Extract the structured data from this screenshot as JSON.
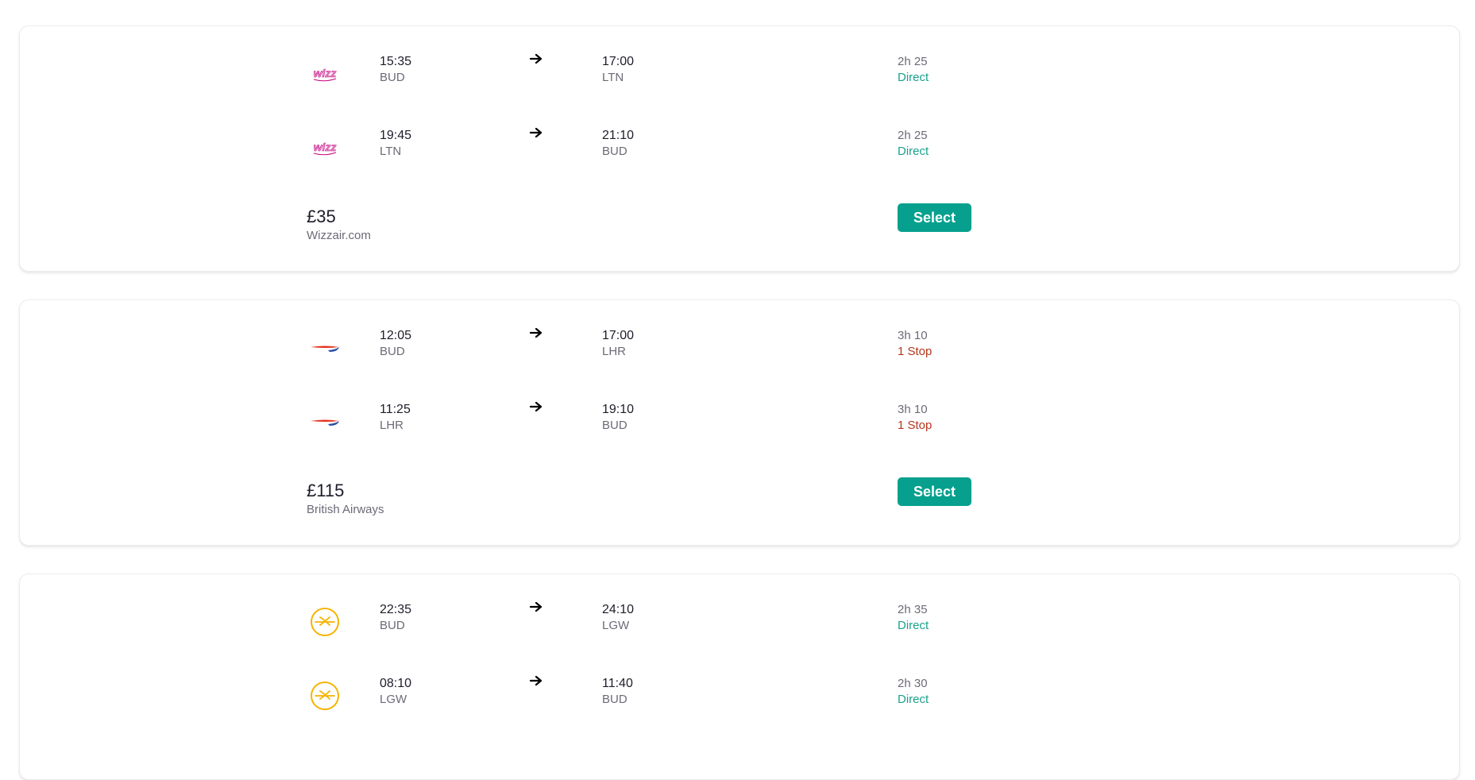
{
  "results": [
    {
      "airline": "Wizz Air",
      "legs": [
        {
          "logo": "wizz-air-logo",
          "dep_time": "15:35",
          "dep_code": "BUD",
          "arr_time": "17:00",
          "arr_code": "LTN",
          "duration": "2h 25",
          "stops": "Direct"
        },
        {
          "logo": "wizz-air-logo",
          "dep_time": "19:45",
          "dep_code": "LTN",
          "arr_time": "21:10",
          "arr_code": "BUD",
          "duration": "2h 25",
          "stops": "Direct"
        }
      ],
      "price": "£35",
      "provider": "Wizzair.com",
      "select_label": "Select"
    },
    {
      "airline": "British Airways",
      "legs": [
        {
          "logo": "british-airways-logo",
          "dep_time": "12:05",
          "dep_code": "BUD",
          "arr_time": "17:00",
          "arr_code": "LHR",
          "duration": "3h 10",
          "stops": "1 Stop"
        },
        {
          "logo": "british-airways-logo",
          "dep_time": "11:25",
          "dep_code": "LHR",
          "arr_time": "19:10",
          "arr_code": "BUD",
          "duration": "3h 10",
          "stops": "1 Stop"
        }
      ],
      "price": "£115",
      "provider": "British Airways",
      "select_label": "Select"
    },
    {
      "airline": "Lufthansa",
      "legs": [
        {
          "logo": "lufthansa-logo",
          "dep_time": "22:35",
          "dep_code": "BUD",
          "arr_time": "24:10",
          "arr_code": "LGW",
          "duration": "2h 35",
          "stops": "Direct"
        },
        {
          "logo": "lufthansa-logo",
          "dep_time": "08:10",
          "dep_code": "LGW",
          "arr_time": "11:40",
          "arr_code": "BUD",
          "duration": "2h 30",
          "stops": "Direct"
        }
      ]
    }
  ],
  "colors": {
    "accent": "#07a08e",
    "direct": "#1aa18c",
    "stop": "#b5361c",
    "lufthansa": "#f5b400",
    "ba_red": "#e4321c",
    "ba_blue": "#2a4fa8",
    "wizz_pink": "#c6007e"
  }
}
